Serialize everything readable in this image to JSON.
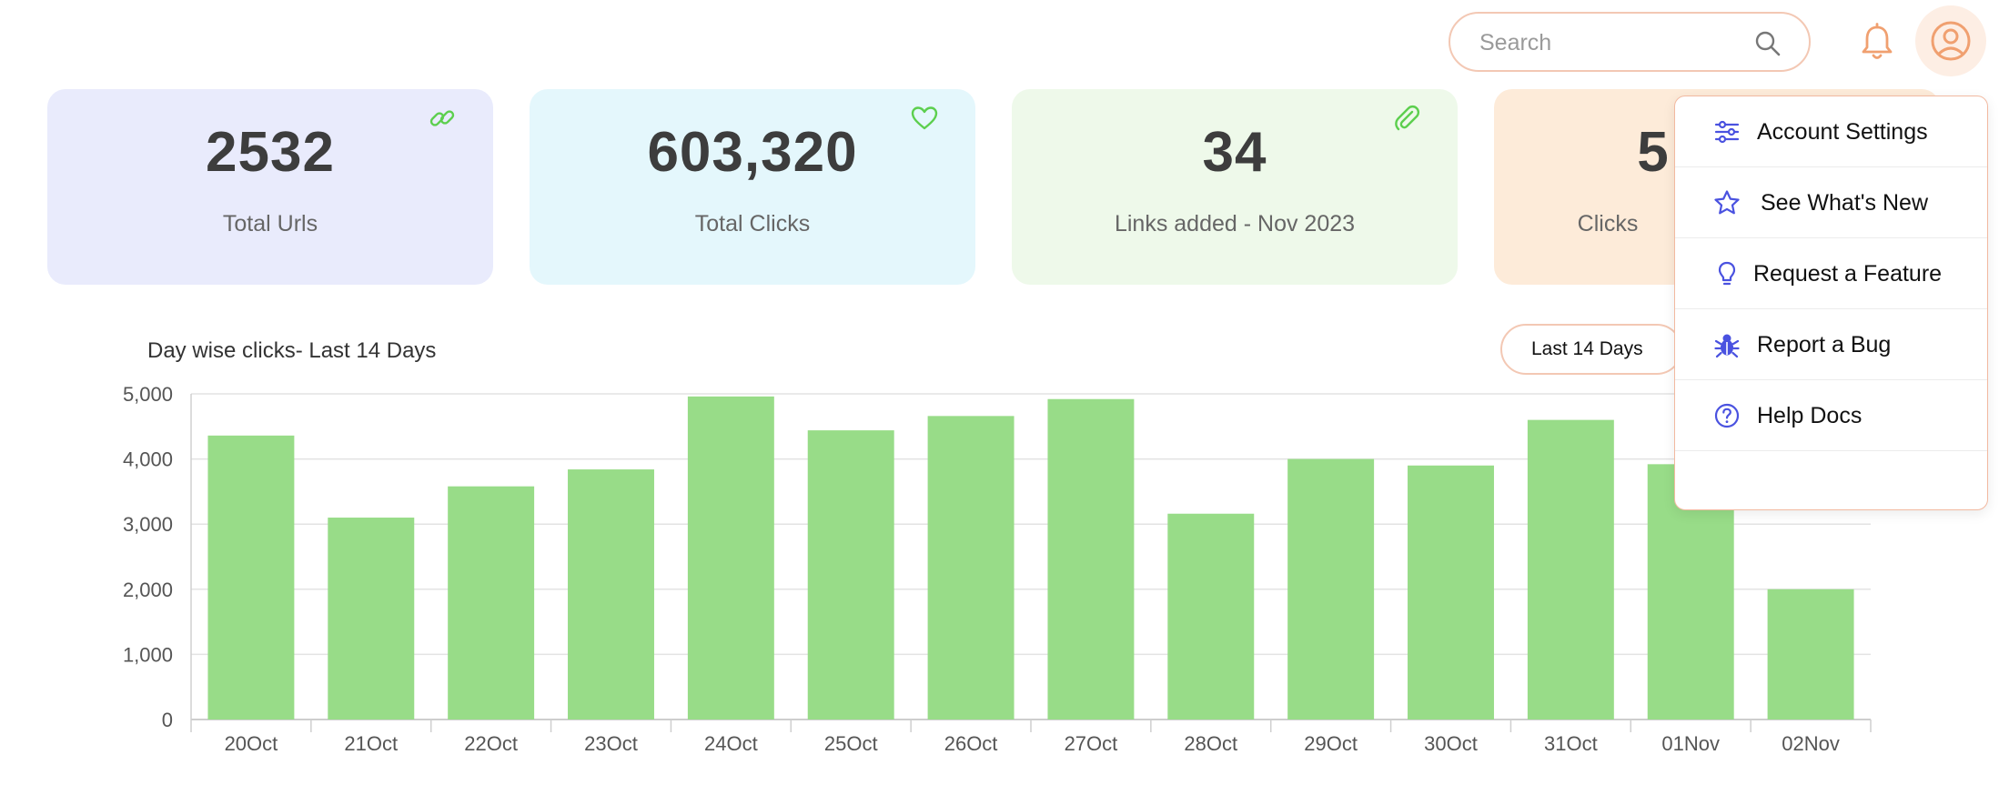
{
  "header": {
    "search_placeholder": "Search",
    "icons": {
      "search": "search-icon",
      "notifications": "bell-icon",
      "profile": "user-circle-icon"
    }
  },
  "cards": [
    {
      "value": "2532",
      "label": "Total Urls",
      "icon": "link-icon",
      "bg": "#e9ebfc"
    },
    {
      "value": "603,320",
      "label": "Total Clicks",
      "icon": "heart-icon",
      "bg": "#e4f7fc"
    },
    {
      "value": "34",
      "label": "Links added - Nov 2023",
      "icon": "paperclip-icon",
      "bg": "#eef9ea"
    },
    {
      "value": "5",
      "label": "Clicks",
      "icon": "",
      "bg": "#fdebd9"
    }
  ],
  "chart_section": {
    "title": "Day wise clicks- Last 14 Days",
    "range_label": "Last 14 Days"
  },
  "chart_data": {
    "type": "bar",
    "categories": [
      "20Oct",
      "21Oct",
      "22Oct",
      "23Oct",
      "24Oct",
      "25Oct",
      "26Oct",
      "27Oct",
      "28Oct",
      "29Oct",
      "30Oct",
      "31Oct",
      "01Nov",
      "02Nov"
    ],
    "values": [
      4360,
      3100,
      3580,
      3840,
      4960,
      4440,
      4660,
      4920,
      3160,
      4000,
      3900,
      4600,
      3920,
      2000
    ],
    "ylim": [
      0,
      5000
    ],
    "yticks": [
      0,
      1000,
      2000,
      3000,
      4000,
      5000
    ],
    "ytick_labels": [
      "0",
      "1,000",
      "2,000",
      "3,000",
      "4,000",
      "5,000"
    ],
    "grid": true,
    "bar_color": "#98dc88"
  },
  "menu": {
    "items": [
      {
        "label": "Account Settings",
        "icon": "sliders-icon"
      },
      {
        "label": "See What's New",
        "icon": "star-icon"
      },
      {
        "label": "Request a Feature",
        "icon": "lightbulb-icon"
      },
      {
        "label": "Report a Bug",
        "icon": "bug-icon"
      },
      {
        "label": "Help Docs",
        "icon": "help-circle-icon"
      }
    ]
  },
  "colors": {
    "accent": "#f3a57a",
    "menu_icon": "#4a52e0",
    "card_icon": "#5ccf4e"
  }
}
